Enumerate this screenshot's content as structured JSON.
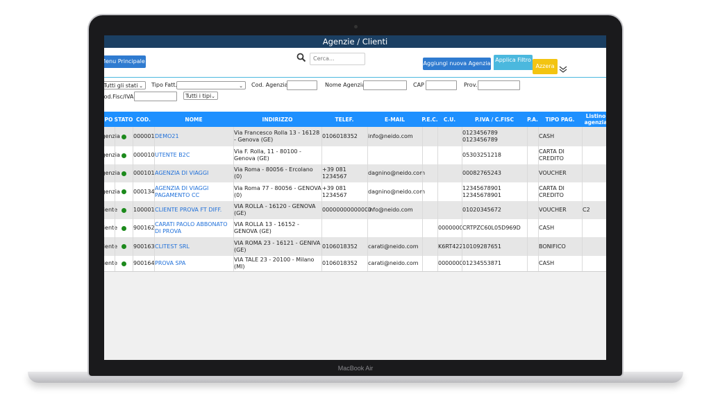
{
  "device": {
    "brand": "MacBook Air"
  },
  "window": {
    "title": "Agenzie / Clienti"
  },
  "toolbar": {
    "menu_label": "Menu Principale",
    "search_placeholder": "Cerca...",
    "add_label": "Aggiungi nuova Agenzia",
    "filter_label": "Applica Filtro",
    "reset_label": "Azzera"
  },
  "filters": {
    "stati_value": "Tutti gli stati",
    "tipo_fatt_label": "Tipo Fatt.",
    "tipo_fatt_value": "",
    "cod_agenzia_label": "Cod. Agenzia",
    "nome_agenzia_label": "Nome Agenzia",
    "cap_label": "CAP",
    "prov_label": "Prov.",
    "codfisc_label": "Cod.Fisc/IVA",
    "tipi_value": "Tutti i tipi"
  },
  "table": {
    "columns": [
      "TIPO",
      "STATO",
      "COD.",
      "NOME",
      "INDIRIZZO",
      "TELEF.",
      "E-MAIL",
      "P.E.C.",
      "C.U.",
      "P.IVA / C.FISC",
      "P.A.",
      "TIPO PAG.",
      "Listino agenzia"
    ],
    "rows": [
      {
        "tipo": "Agenzia",
        "cod": "000001",
        "nome": "DEMO21",
        "indirizzo": "Via Francesco Rolla 13 - 16128 - Genova (GE)",
        "telef": "0106018352",
        "email": "info@neido.com",
        "pec": "",
        "cu": "",
        "piva": "0123456789 0123456789",
        "pa": "",
        "tipo_pag": "CASH",
        "listino": ""
      },
      {
        "tipo": "Agenzia",
        "cod": "000010",
        "nome": "UTENTE B2C",
        "indirizzo": "Via F. Rolla, 11 - 80100 - Genova (GE)",
        "telef": "",
        "email": "",
        "pec": "",
        "cu": "",
        "piva": "05303251218",
        "pa": "",
        "tipo_pag": "CARTA DI CREDITO",
        "listino": ""
      },
      {
        "tipo": "Agenzia",
        "cod": "000101",
        "nome": "AGENZIA DI VIAGGI",
        "indirizzo": "Via Roma - 80056 - Ercolano (0)",
        "telef": "+39 081 1234567",
        "email": "dagnino@neido.com",
        "pec": "",
        "cu": "",
        "piva": "00082765243",
        "pa": "",
        "tipo_pag": "VOUCHER",
        "listino": ""
      },
      {
        "tipo": "Agenzia",
        "cod": "000134",
        "nome": "AGENZIA DI VIAGGI PAGAMENTO CC",
        "indirizzo": "Via Roma 77 - 80056 - GENOVA (0)",
        "telef": "+39 081 1234567",
        "email": "dagnino@neido.com",
        "pec": "",
        "cu": "",
        "piva": "12345678901 12345678901",
        "pa": "",
        "tipo_pag": "CARTA DI CREDITO",
        "listino": ""
      },
      {
        "tipo": "Cliente",
        "cod": "100001",
        "nome": "CLIENTE PROVA FT DIFF.",
        "indirizzo": "VIA ROLLA - 16120 - GENOVA (GE)",
        "telef": "00000000000000",
        "email": "info@neido.com",
        "pec": "",
        "cu": "",
        "piva": "01020345672",
        "pa": "",
        "tipo_pag": "VOUCHER",
        "listino": "C2"
      },
      {
        "tipo": "Cliente",
        "cod": "900162",
        "nome": "CARATI PAOLO ABBONATO DI PROVA",
        "indirizzo": "VIA ROLLA 13 - 16152 - GENOVA (GE)",
        "telef": "",
        "email": "",
        "pec": "",
        "cu": "0000000",
        "piva": "CRTPZC60L05D969D",
        "pa": "",
        "tipo_pag": "CASH",
        "listino": ""
      },
      {
        "tipo": "Cliente",
        "cod": "900163",
        "nome": "CLITEST SRL",
        "indirizzo": "VIA ROMA 23 - 16121 - GENIVA (GE)",
        "telef": "0106018352",
        "email": "carati@neido.com",
        "pec": "",
        "cu": "K6RT422",
        "piva": "10109287651",
        "pa": "",
        "tipo_pag": "BONIFICO",
        "listino": ""
      },
      {
        "tipo": "Cliente",
        "cod": "900164",
        "nome": "PROVA SPA",
        "indirizzo": "VIA TALE 23 - 20100 - Milano (MI)",
        "telef": "0106018352",
        "email": "carati@neido.com",
        "pec": "",
        "cu": "0000000",
        "piva": "01234553871",
        "pa": "",
        "tipo_pag": "CASH",
        "listino": ""
      }
    ]
  },
  "colors": {
    "header_bar": "#1b3f62",
    "table_header": "#1e90ff",
    "primary_button": "#2f7bd0",
    "filter_button": "#4bb8de",
    "reset_button": "#f3c411",
    "status_active": "#1c8a1c",
    "link": "#1e6fd9"
  }
}
